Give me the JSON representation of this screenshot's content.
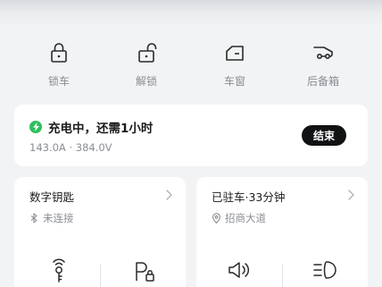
{
  "controls": [
    {
      "label": "锁车",
      "icon": "lock-icon"
    },
    {
      "label": "解锁",
      "icon": "unlock-icon"
    },
    {
      "label": "车窗",
      "icon": "window-icon"
    },
    {
      "label": "后备箱",
      "icon": "trunk-icon"
    }
  ],
  "charging": {
    "status": "充电中，还需1小时",
    "detail": "143.0A · 384.0V",
    "end_label": "结束",
    "accent_color": "#2fbf5b"
  },
  "digital_key": {
    "title": "数字钥匙",
    "status": "未连接",
    "status_icon": "bluetooth-icon",
    "actions": [
      "key-icon",
      "parking-lock-icon"
    ]
  },
  "parking": {
    "title": "已驻车·33分钟",
    "location": "招商大道",
    "location_icon": "location-pin-icon",
    "actions": [
      "horn-icon",
      "headlight-icon"
    ]
  }
}
